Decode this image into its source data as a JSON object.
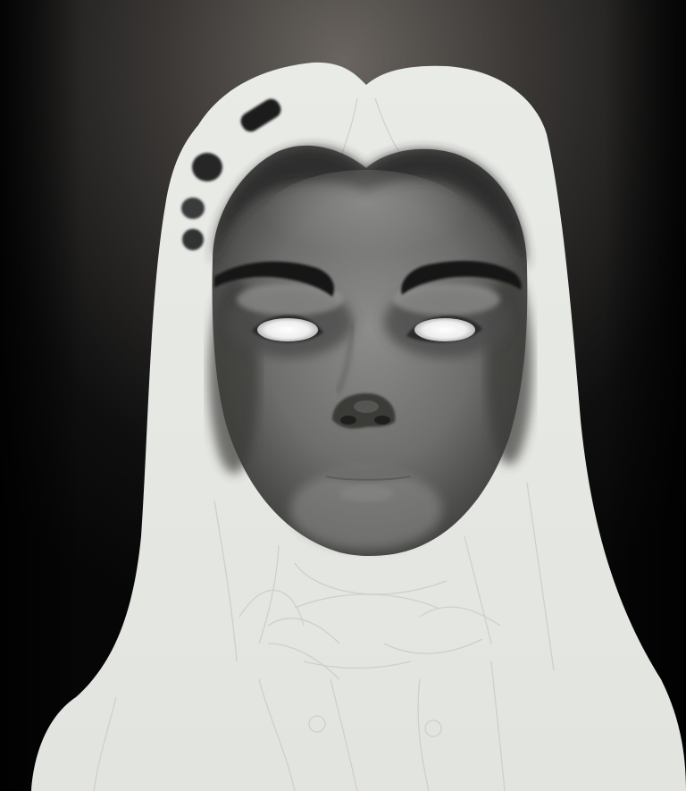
{
  "image": {
    "subject": "digital-painting-in-progress",
    "colors": {
      "background_dark": "#0b0b0b",
      "background_glow": "#6a6560",
      "hair_light": "#e6e8e4",
      "skin_mid": "#7d7d7b",
      "skin_dark": "#3f3f3e",
      "eye_white": "#f4f4f4",
      "brow_dark": "#151515"
    }
  }
}
